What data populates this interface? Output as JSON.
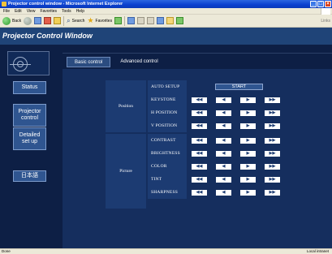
{
  "window": {
    "title": "Projector control window - Microsoft Internet Explorer"
  },
  "menu": [
    "File",
    "Edit",
    "View",
    "Favorites",
    "Tools",
    "Help"
  ],
  "toolbar": {
    "back_label": "Back",
    "search_label": "Search",
    "favorites_label": "Favorites",
    "links_label": "Links"
  },
  "app": {
    "title": "Projector Control Window"
  },
  "sidebar": {
    "status": "Status",
    "projector": "Projector\ncontrol",
    "detailed": "Detailed\nset up",
    "language": "日本語"
  },
  "tabs": {
    "basic": "Basic control",
    "advanced": "Advanced control"
  },
  "groups": {
    "position": "Position",
    "picture": "Picture"
  },
  "rows": {
    "auto_setup": "AUTO SETUP",
    "keystone": "KEYSTONE",
    "h_position": "H POSITION",
    "v_position": "V POSITION",
    "contrast": "CONTRAST",
    "brightness": "BRIGHTNESS",
    "color": "COLOR",
    "tint": "TINT",
    "sharpness": "SHARPNESS"
  },
  "controls": {
    "start": "START",
    "fast_back": "◀◀",
    "back": "◀",
    "fwd": "▶",
    "fast_fwd": "▶▶"
  },
  "status_bar": {
    "left": "Done",
    "right": "Local intranet"
  }
}
